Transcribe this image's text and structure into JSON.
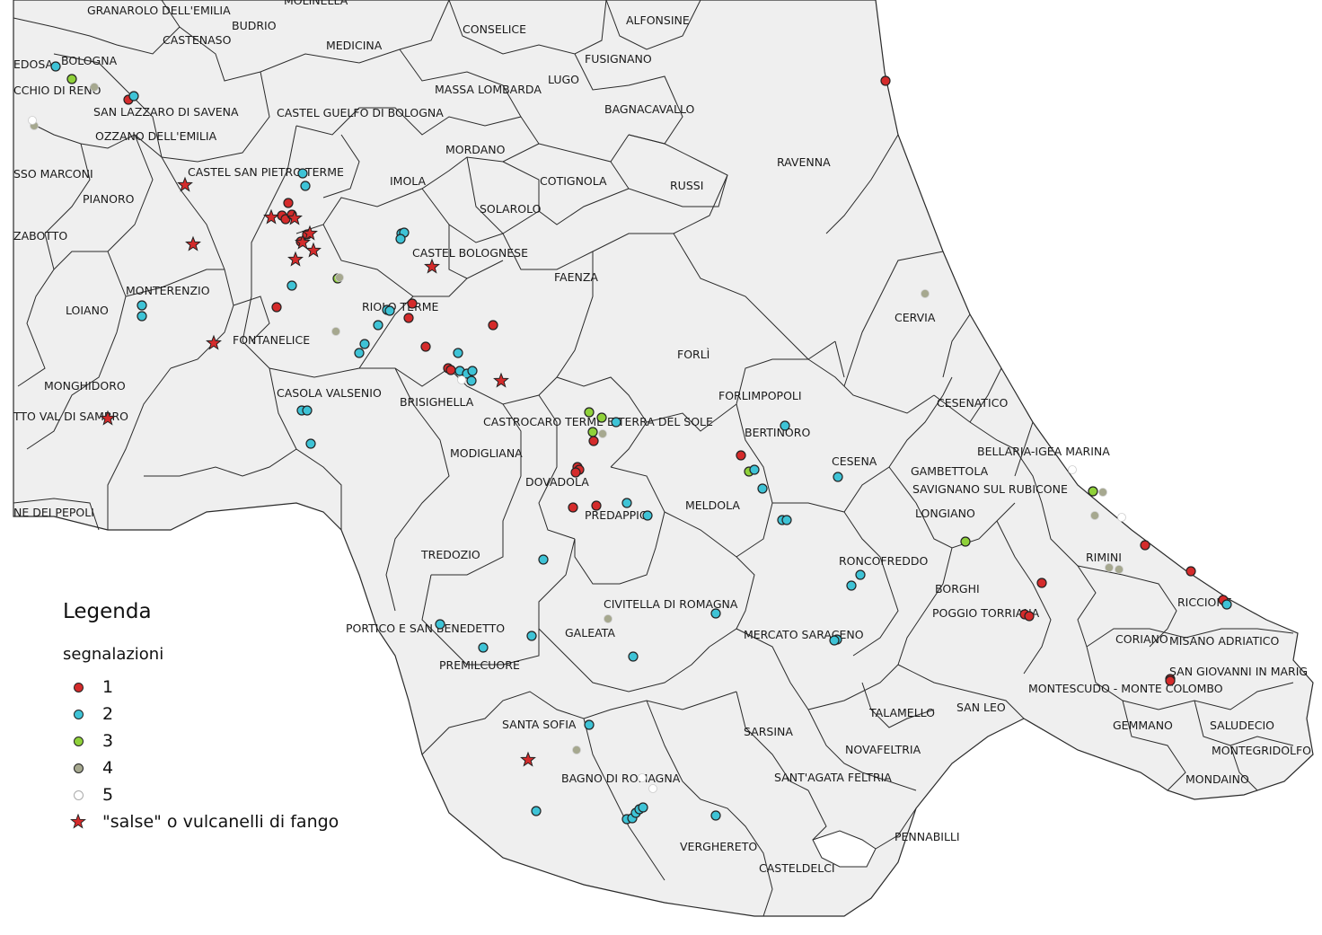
{
  "map": {
    "municipalities": [
      "GRANAROLO DELL'EMILIA",
      "BUDRIO",
      "MOLINELLA",
      "CONSELICE",
      "ALFONSINE",
      "CASTENASO",
      "MEDICINA",
      "FUSIGNANO",
      "BOLOGNA",
      "EDOSA",
      "LUGO",
      "MASSA LOMBARDA",
      "CCHIO DI RENO",
      "BAGNACAVALLO",
      "SAN LAZZARO DI SAVENA",
      "CASTEL GUELFO DI BOLOGNA",
      "OZZANO DELL'EMILIA",
      "MORDANO",
      "RAVENNA",
      "SSO MARCONI",
      "CASTEL SAN PIETRO TERME",
      "COTIGNOLA",
      "IMOLA",
      "RUSSI",
      "PIANORO",
      "SOLAROLO",
      "ZABOTTO",
      "CASTEL BOLOGNESE",
      "FAENZA",
      "MONTERENZIO",
      "CERVIA",
      "LOIANO",
      "RIOLO TERME",
      "FONTANELICE",
      "FORLÌ",
      "MONGHIDORO",
      "CASOLA VALSENIO",
      "FORLIMPOPOLI",
      "CESENATICO",
      "BRISIGHELLA",
      "TTO VAL DI SAMBRO",
      "CASTROCARO TERME E TERRA DEL SOLE",
      "BERTINORO",
      "BELLARIA-IGEA MARINA",
      "MODIGLIANA",
      "CESENA",
      "GAMBETTOLA",
      "DOVADOLA",
      "SAVIGNANO SUL RUBICONE",
      "NE DEI PEPOLI",
      "PREDAPPIO",
      "MELDOLA",
      "LONGIANO",
      "TREDOZIO",
      "RONCOFREDDO",
      "RIMINI",
      "BORGHI",
      "RICCIONE",
      "CIVITELLA DI ROMAGNA",
      "POGGIO TORRIANA",
      "PORTICO E SAN BENEDETTO",
      "GALEATA",
      "MERCATO SARACENO",
      "CORIANO",
      "MISANO ADRIATICO",
      "PREMILCUORE",
      "SAN GIOVANNI IN MARIG",
      "MONTESCUDO - MONTE COLOMBO",
      "TALAMELLO",
      "SAN LEO",
      "SANTA SOFIA",
      "GEMMANO",
      "SALUDECIO",
      "SARSINA",
      "NOVAFELTRIA",
      "MONTEGRIDOLFO",
      "BAGNO DI ROMAGNA",
      "SANT'AGATA FELTRIA",
      "MONDAINO",
      "VERGHERETO",
      "PENNABILLI",
      "CASTELDELCI"
    ],
    "colors": {
      "land": "#efefef",
      "boundary": "#2a2a2a",
      "sea": "#ffffff",
      "cat1": "#d42b2b",
      "cat2": "#3ec3d6",
      "cat3": "#8fd13a",
      "cat4": "#a6a88f",
      "cat5": "#ffffff",
      "star": "#d42b2b"
    }
  },
  "legend": {
    "title": "Legenda",
    "subtitle": "segnalazioni",
    "items": [
      {
        "label": "1",
        "symbol": "dot",
        "color": "#d42b2b"
      },
      {
        "label": "2",
        "symbol": "dot",
        "color": "#3ec3d6"
      },
      {
        "label": "3",
        "symbol": "dot",
        "color": "#8fd13a"
      },
      {
        "label": "4",
        "symbol": "dot",
        "color": "#a6a88f"
      },
      {
        "label": "5",
        "symbol": "dot",
        "color": "#ffffff"
      },
      {
        "label": "\"salse\" o vulcanelli di fango",
        "symbol": "star-icon",
        "color": "#d42b2b"
      }
    ]
  }
}
